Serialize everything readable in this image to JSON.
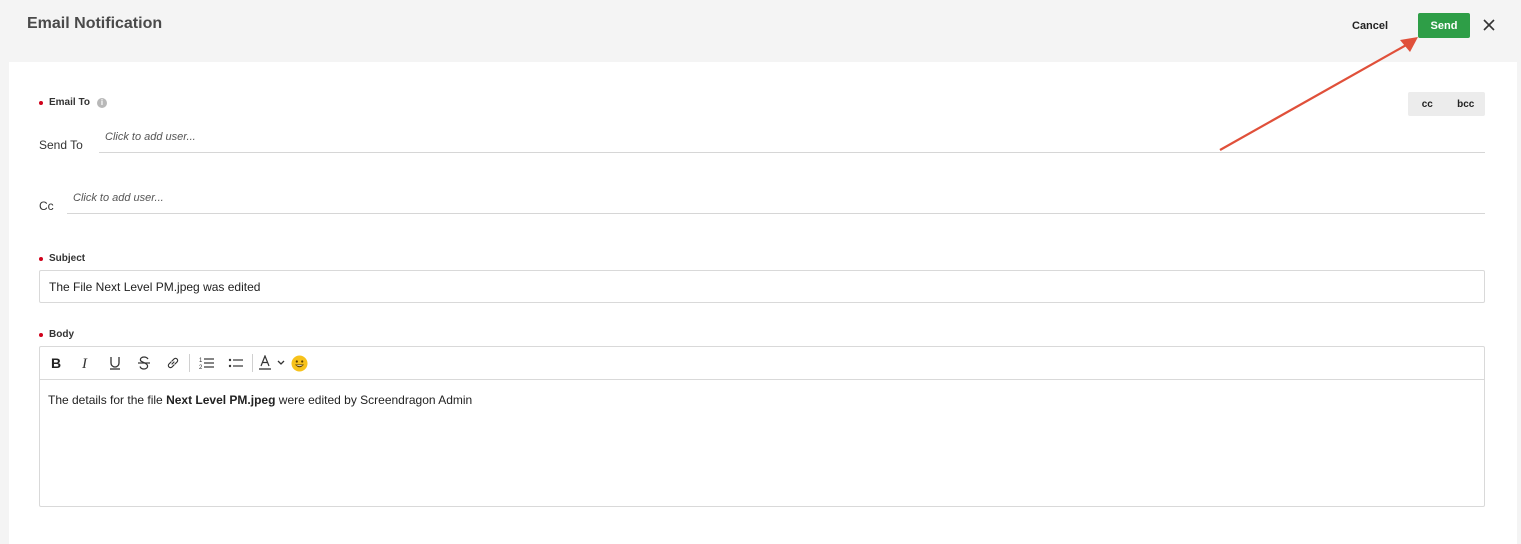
{
  "header": {
    "title": "Email Notification",
    "cancel_label": "Cancel",
    "send_label": "Send",
    "close_icon": "close-icon"
  },
  "email_to": {
    "label": "Email To",
    "info_icon": "i",
    "cc_label": "cc",
    "bcc_label": "bcc",
    "send_to_label": "Send To",
    "send_to_placeholder": "Click to add user...",
    "cc_field_label": "Cc",
    "cc_placeholder": "Click to add user..."
  },
  "subject": {
    "label": "Subject",
    "value": "The File Next Level PM.jpeg was edited"
  },
  "body": {
    "label": "Body",
    "toolbar": [
      "bold-icon",
      "italic-icon",
      "underline-icon",
      "strikethrough-icon",
      "link-icon",
      "numbered-list-icon",
      "bulleted-list-icon",
      "text-color-icon",
      "chevron-down-icon",
      "emoji-icon"
    ],
    "text_before": "The details for the file ",
    "text_bold": "Next Level PM.jpeg",
    "text_after": " were edited by Screendragon Admin"
  },
  "colors": {
    "send_button": "#2e9e47",
    "required_dot": "#d0021b",
    "annotation_arrow": "#e0503a"
  }
}
